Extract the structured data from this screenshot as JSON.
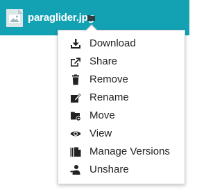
{
  "file": {
    "name": "paraglider.jpg",
    "icon": "image-file-icon",
    "indicator_icon": "folder-icon"
  },
  "colors": {
    "accent": "#13a1b4",
    "icon": "#222222"
  },
  "menu": {
    "items": [
      {
        "label": "Download",
        "icon": "download-icon"
      },
      {
        "label": "Share",
        "icon": "share-icon"
      },
      {
        "label": "Remove",
        "icon": "trash-icon"
      },
      {
        "label": "Rename",
        "icon": "rename-icon"
      },
      {
        "label": "Move",
        "icon": "move-folder-icon"
      },
      {
        "label": "View",
        "icon": "eye-icon"
      },
      {
        "label": "Manage Versions",
        "icon": "versions-icon"
      },
      {
        "label": "Unshare",
        "icon": "unshare-icon"
      }
    ]
  }
}
